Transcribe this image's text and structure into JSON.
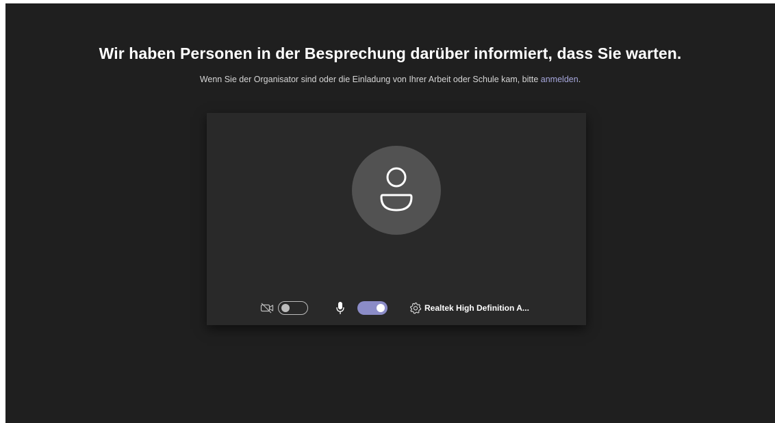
{
  "lobby": {
    "heading": "Wir haben Personen in der Besprechung darüber informiert, dass Sie warten.",
    "subtext_prefix": "Wenn Sie der Organisator sind oder die Einladung von Ihrer Arbeit oder Schule kam, bitte ",
    "signin_link": "anmelden",
    "subtext_suffix": "."
  },
  "preview": {
    "avatar_icon": "person-icon",
    "camera": {
      "icon": "camera-off-icon",
      "enabled": false
    },
    "microphone": {
      "icon": "microphone-icon",
      "enabled": true
    },
    "audio_device": {
      "icon": "gear-icon",
      "label": "Realtek High Definition A..."
    }
  },
  "colors": {
    "background": "#1f1f1f",
    "panel": "#292929",
    "avatar": "#525252",
    "accent": "#8b8cc7",
    "link": "#a6a7dc"
  }
}
